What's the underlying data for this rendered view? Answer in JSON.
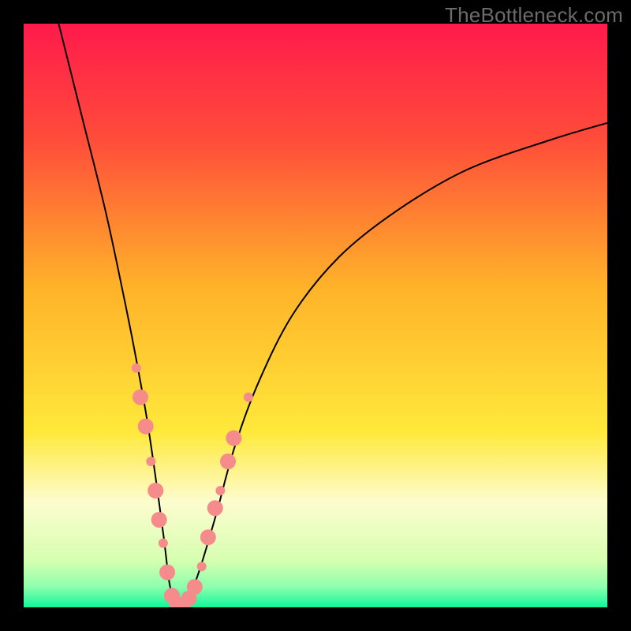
{
  "watermark": {
    "text": "TheBottleneck.com"
  },
  "chart_data": {
    "type": "line",
    "title": "",
    "xlabel": "",
    "ylabel": "",
    "xlim": [
      0,
      100
    ],
    "ylim": [
      0,
      100
    ],
    "grid": false,
    "legend": false,
    "background_gradient_stops": [
      {
        "offset": 0.0,
        "color": "#ff1a4b"
      },
      {
        "offset": 0.2,
        "color": "#ff4d3a"
      },
      {
        "offset": 0.45,
        "color": "#ffb229"
      },
      {
        "offset": 0.7,
        "color": "#ffe93b"
      },
      {
        "offset": 0.82,
        "color": "#fdfccf"
      },
      {
        "offset": 0.92,
        "color": "#d6ffb0"
      },
      {
        "offset": 0.965,
        "color": "#8cffae"
      },
      {
        "offset": 1.0,
        "color": "#11f79a"
      }
    ],
    "series": [
      {
        "name": "bottleneck-curve",
        "color": "#000000",
        "x": [
          6,
          10,
          14,
          17,
          19,
          21,
          22.5,
          24,
          25,
          26,
          27,
          28,
          30,
          33,
          36,
          40,
          46,
          54,
          64,
          76,
          90,
          100
        ],
        "values": [
          100,
          84,
          68,
          54,
          44,
          33,
          23,
          12,
          4,
          1,
          0,
          1,
          6,
          16,
          27,
          38,
          50,
          60,
          68,
          75,
          80,
          83
        ]
      }
    ],
    "markers": {
      "color": "#f58b8b",
      "stroke": "#f58b8b",
      "radius_small": 6,
      "radius_large": 10,
      "points": [
        {
          "x": 19.3,
          "y": 41,
          "r": "small"
        },
        {
          "x": 20.0,
          "y": 36,
          "r": "large"
        },
        {
          "x": 20.9,
          "y": 31,
          "r": "large"
        },
        {
          "x": 21.8,
          "y": 25,
          "r": "small"
        },
        {
          "x": 22.6,
          "y": 20,
          "r": "large"
        },
        {
          "x": 23.2,
          "y": 15,
          "r": "large"
        },
        {
          "x": 23.9,
          "y": 11,
          "r": "small"
        },
        {
          "x": 24.6,
          "y": 6,
          "r": "large"
        },
        {
          "x": 25.4,
          "y": 2,
          "r": "large"
        },
        {
          "x": 26.3,
          "y": 0.5,
          "r": "large"
        },
        {
          "x": 27.3,
          "y": 0.5,
          "r": "large"
        },
        {
          "x": 28.3,
          "y": 1.5,
          "r": "large"
        },
        {
          "x": 29.3,
          "y": 3.5,
          "r": "large"
        },
        {
          "x": 30.5,
          "y": 7,
          "r": "small"
        },
        {
          "x": 31.6,
          "y": 12,
          "r": "large"
        },
        {
          "x": 32.8,
          "y": 17,
          "r": "large"
        },
        {
          "x": 33.7,
          "y": 20,
          "r": "small"
        },
        {
          "x": 35.0,
          "y": 25,
          "r": "large"
        },
        {
          "x": 36.0,
          "y": 29,
          "r": "large"
        },
        {
          "x": 38.5,
          "y": 36,
          "r": "small"
        }
      ]
    }
  }
}
